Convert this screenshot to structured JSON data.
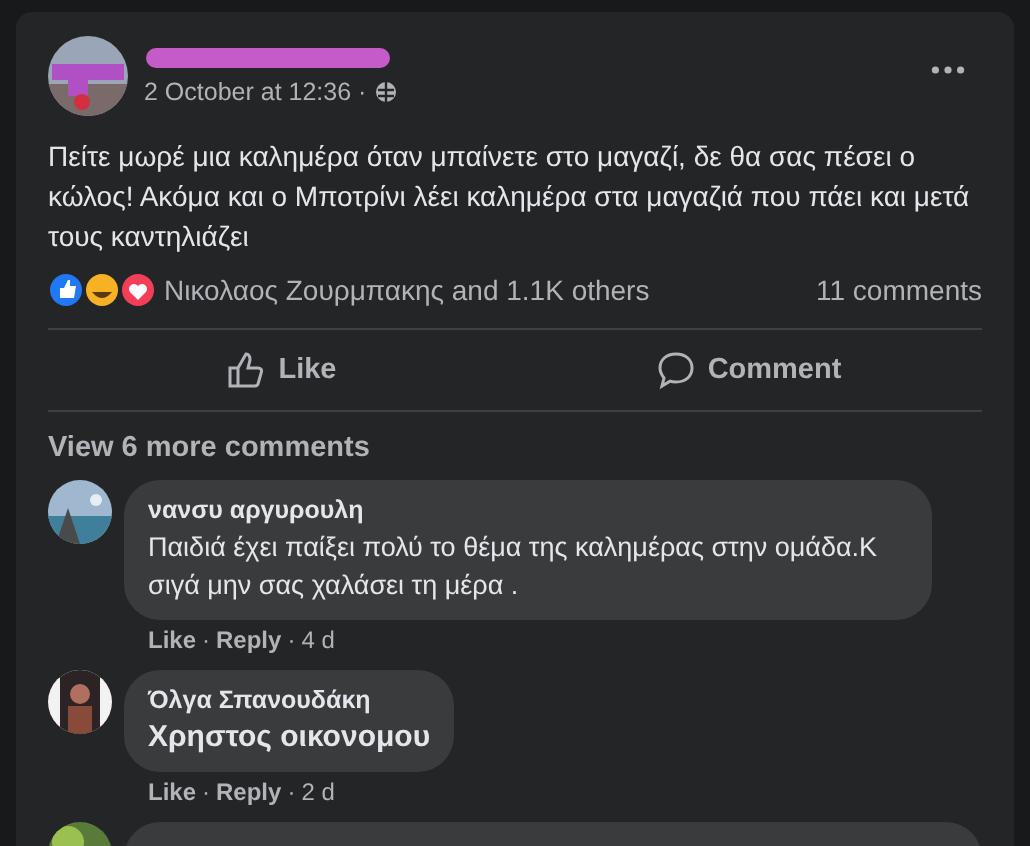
{
  "post": {
    "date": "2 October at 12:36 ·",
    "text": "Πείτε μωρέ μια καλημέρα όταν μπαίνετε στο μαγαζί, δε θα σας πέσει ο κώλος! Ακόμα και ο Μποτρίνι λέει καλημέρα στα μαγαζιά που πάει και μετά τους καντηλιάζει",
    "reactions_text": "Νικολαος Ζουρμπακης and 1.1K others",
    "comments_count": "11 comments"
  },
  "actions": [
    "Like",
    "Comment"
  ],
  "view_more": "View 6 more comments",
  "comments": [
    {
      "author": "νανσυ αργυρουλη",
      "text": "Παιδιά έχει παίξει πολύ το θέμα της καλημέρας στην ομάδα.Κ σιγά μην σας χαλάσει τη μέρα .",
      "meta": [
        "Like",
        "Reply",
        "4 d"
      ],
      "separator": "·"
    },
    {
      "author": "Όλγα Σπανουδάκη",
      "text": "Χρηστος οικονομου",
      "meta": [
        "Like",
        "Reply",
        "2 d"
      ],
      "separator": "·"
    }
  ]
}
